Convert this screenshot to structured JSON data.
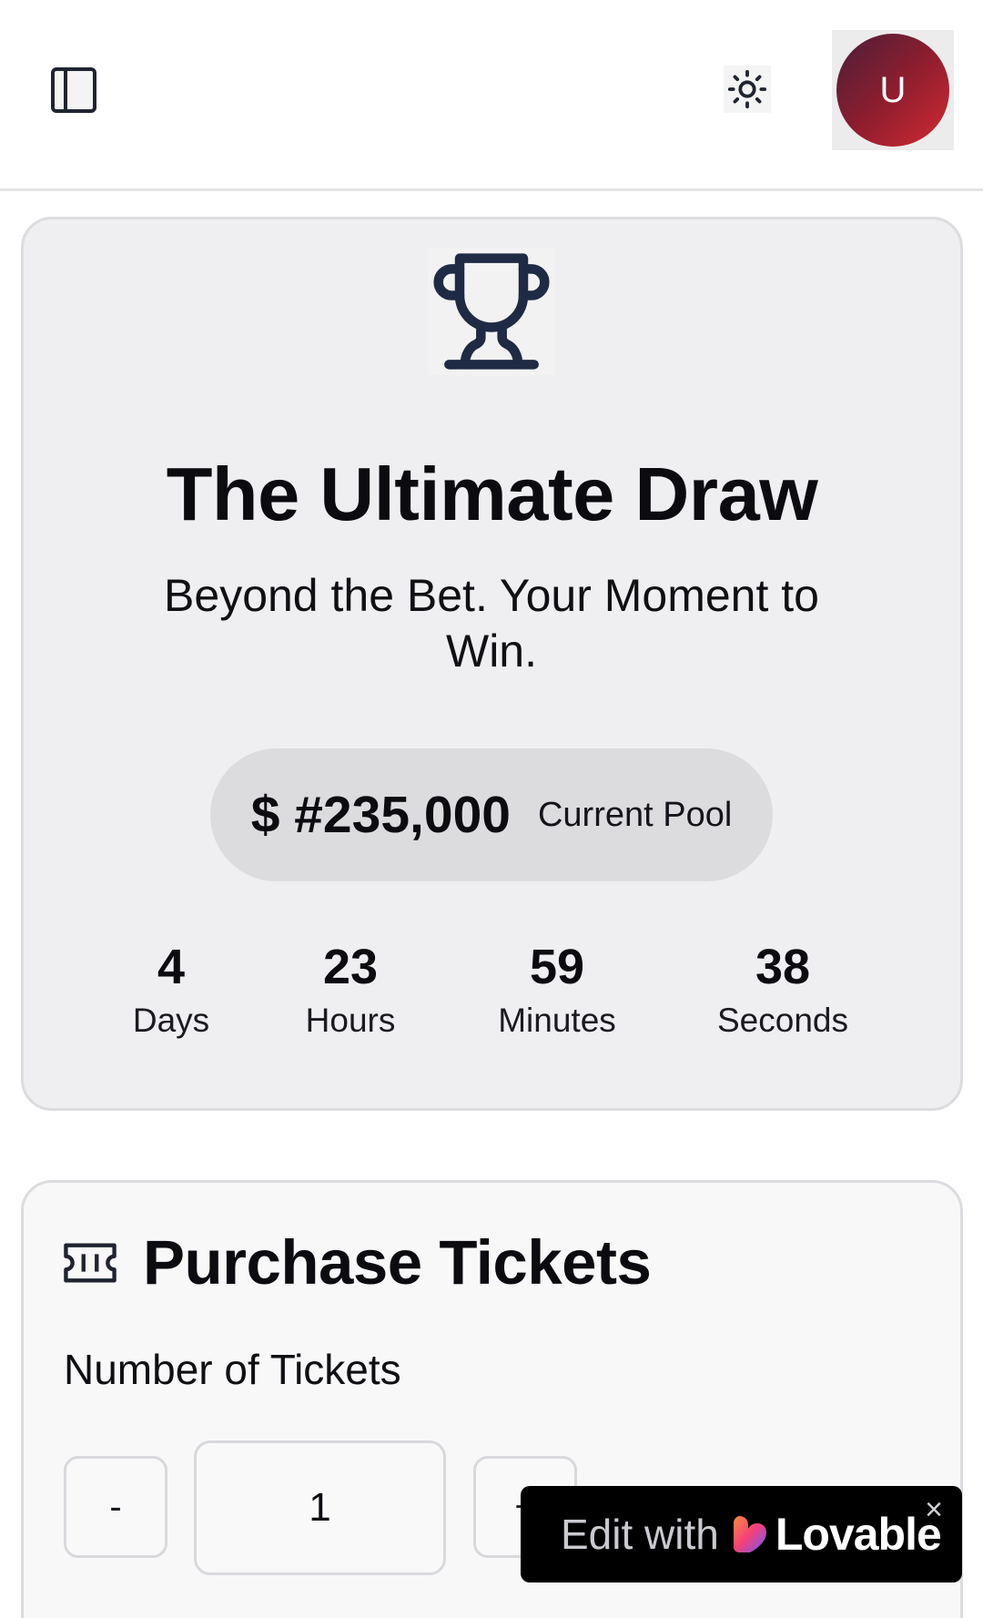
{
  "header": {
    "sidebar_toggle_icon": "panel-left-icon",
    "theme_icon": "sun-icon",
    "avatar_initial": "U"
  },
  "hero": {
    "icon": "trophy-icon",
    "title": "The Ultimate Draw",
    "subtitle": "Beyond the Bet. Your Moment to Win.",
    "pool_amount": "$ #235,000",
    "pool_label": "Current Pool",
    "countdown": [
      {
        "value": "4",
        "label": "Days"
      },
      {
        "value": "23",
        "label": "Hours"
      },
      {
        "value": "59",
        "label": "Minutes"
      },
      {
        "value": "38",
        "label": "Seconds"
      }
    ]
  },
  "purchase": {
    "icon": "ticket-icon",
    "title": "Purchase Tickets",
    "quantity_label": "Number of Tickets",
    "decrement_label": "-",
    "increment_label": "+",
    "quantity_value": "1"
  },
  "badge": {
    "edit_text": "Edit with",
    "brand": "Lovable",
    "close": "×"
  },
  "colors": {
    "avatar_gradient_start": "#4a1f3a",
    "avatar_gradient_end": "#d22a32",
    "card_bg": "#efeff1",
    "pill_bg": "#dcdcdf"
  }
}
